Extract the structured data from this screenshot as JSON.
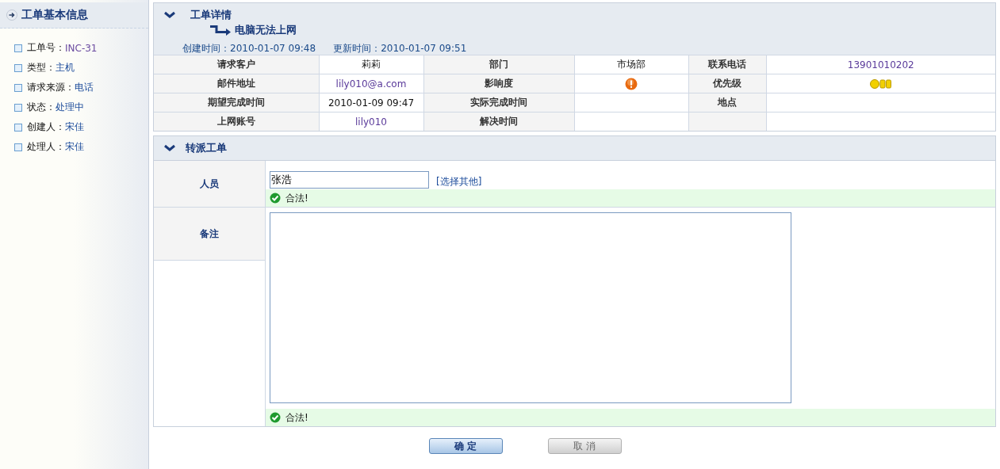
{
  "sidebar": {
    "title": "工单基本信息",
    "items": [
      {
        "label": "工单号：",
        "value": "INC-31",
        "kind": "code"
      },
      {
        "label": "类型：",
        "value": "主机",
        "kind": "link"
      },
      {
        "label": "请求来源：",
        "value": "电话",
        "kind": "link"
      },
      {
        "label": "状态：",
        "value": "处理中",
        "kind": "link"
      },
      {
        "label": "创建人：",
        "value": "宋佳",
        "kind": "link"
      },
      {
        "label": "处理人：",
        "value": "宋佳",
        "kind": "link"
      }
    ]
  },
  "details": {
    "title": "工单详情",
    "subject": "电脑无法上网",
    "created": {
      "label": "创建时间：",
      "value": "2010-01-07 09:48"
    },
    "updated": {
      "label": "更新时间：",
      "value": "2010-01-07 09:51"
    },
    "rows": [
      [
        {
          "kind": "label",
          "text": "请求客户"
        },
        {
          "kind": "text",
          "text": "莉莉"
        },
        {
          "kind": "label",
          "text": "部门"
        },
        {
          "kind": "text",
          "text": "市场部"
        },
        {
          "kind": "label",
          "text": "联系电话"
        },
        {
          "kind": "code",
          "text": "13901010202"
        }
      ],
      [
        {
          "kind": "label",
          "text": "邮件地址"
        },
        {
          "kind": "code",
          "text": "lily010@a.com"
        },
        {
          "kind": "label",
          "text": "影响度"
        },
        {
          "kind": "impact"
        },
        {
          "kind": "label",
          "text": "优先级"
        },
        {
          "kind": "priority"
        }
      ],
      [
        {
          "kind": "label",
          "text": "期望完成时间"
        },
        {
          "kind": "text",
          "text": "2010-01-09 09:47"
        },
        {
          "kind": "label",
          "text": "实际完成时间"
        },
        {
          "kind": "blank"
        },
        {
          "kind": "label",
          "text": "地点"
        },
        {
          "kind": "blank"
        }
      ],
      [
        {
          "kind": "label",
          "text": "上网账号"
        },
        {
          "kind": "code",
          "text": "lily010"
        },
        {
          "kind": "label",
          "text": "解决时间"
        },
        {
          "kind": "blank"
        },
        {
          "kind": "blankgray"
        },
        {
          "kind": "blank"
        }
      ]
    ]
  },
  "transfer": {
    "title": "转派工单",
    "person": {
      "label": "人员",
      "value": "张浩",
      "link": "[选择其他]",
      "status": "合法!"
    },
    "note": {
      "label": "备注",
      "status": "合法!"
    }
  },
  "buttons": [
    {
      "label": "确 定",
      "disabled": false
    },
    {
      "label": "取 消",
      "disabled": true
    }
  ]
}
